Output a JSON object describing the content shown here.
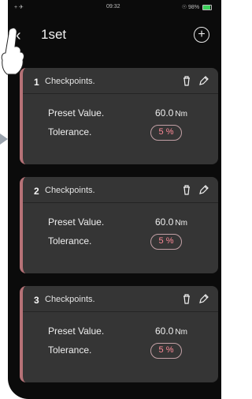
{
  "status_bar": {
    "left_icons": "+ ✈",
    "time": "09:32",
    "right_text": "☉ 98%"
  },
  "nav": {
    "back_icon": "back-chevron-icon",
    "title": "1set",
    "add_icon": "plus-icon"
  },
  "cards": [
    {
      "index": "1",
      "title": "Checkpoints.",
      "preset_label": "Preset Value.",
      "preset_value": "60.0",
      "preset_unit": "Nm",
      "tolerance_label": "Tolerance.",
      "tolerance_value": "5 %"
    },
    {
      "index": "2",
      "title": "Checkpoints.",
      "preset_label": "Preset Value.",
      "preset_value": "60.0",
      "preset_unit": "Nm",
      "tolerance_label": "Tolerance.",
      "tolerance_value": "5 %"
    },
    {
      "index": "3",
      "title": "Checkpoints.",
      "preset_label": "Preset Value.",
      "preset_value": "60.0",
      "preset_unit": "Nm",
      "tolerance_label": "Tolerance.",
      "tolerance_value": "5 %"
    }
  ],
  "colors": {
    "background": "#0b0b0b",
    "card": "#353535",
    "accent": "#b67277",
    "tolerance_text": "#ff8a98"
  }
}
